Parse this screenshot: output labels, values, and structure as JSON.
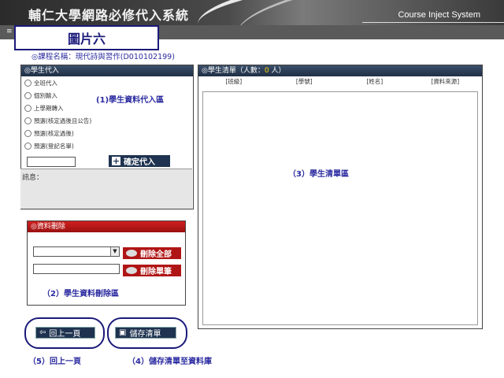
{
  "header": {
    "title_cn": "輔仁大學網路必修代入系統",
    "title_en": "Course Inject System"
  },
  "pic_label": "圖片六",
  "course_name": "◎課程名稱：現代詩與習作(D010102199)",
  "inject_panel": {
    "title": "◎學生代入",
    "options": [
      "全班代入",
      "個別輸入",
      "上學期轉入",
      "預選(核定過後且公告)",
      "預選(核定過後)",
      "預選(登記名單)"
    ],
    "area_label": "(1)學生資料代入區",
    "confirm_label": "確定代入",
    "message_label": "訊息："
  },
  "delete_panel": {
    "title": "◎資料刪除",
    "delete_all_label": "刪除全部",
    "delete_one_label": "刪除單筆",
    "area_label": "（2）學生資料刪除區"
  },
  "list_panel": {
    "title_prefix": "◎學生清單（人數：",
    "count": "0",
    "title_suffix": " 人）",
    "columns": [
      "[班級]",
      "[學號]",
      "[姓名]",
      "[資料來源]"
    ],
    "area_label": "（3）學生清單區"
  },
  "footer": {
    "back_label": "回上一頁",
    "save_label": "儲存清單",
    "back_caption": "（5）回上一頁",
    "save_caption": "（4）儲存清單至資料庫"
  },
  "colors": {
    "accent_navy": "#1f3350",
    "delete_red": "#b01515",
    "annotation_blue": "#2a2aa0"
  }
}
